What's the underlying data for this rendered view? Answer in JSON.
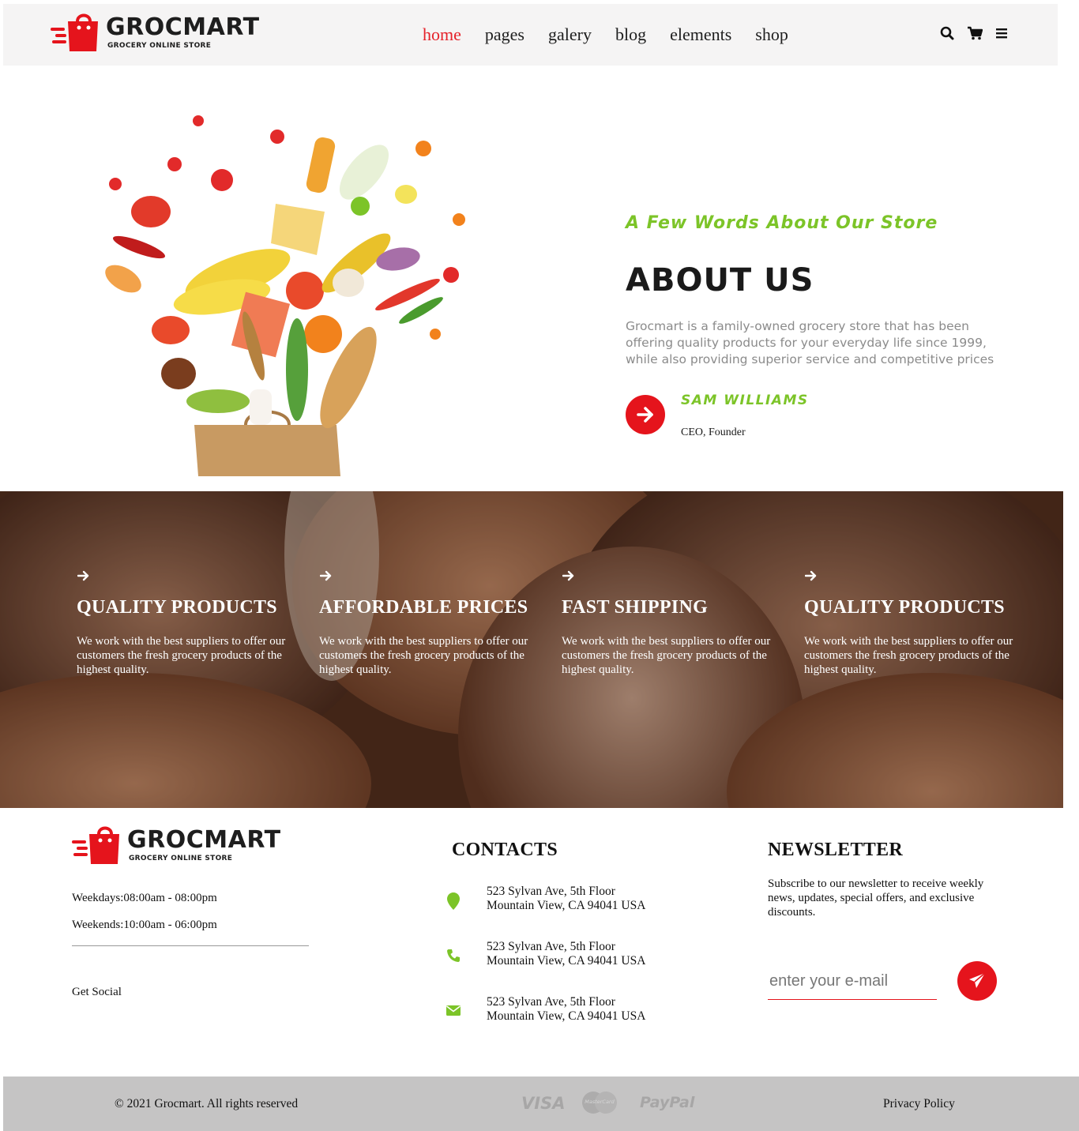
{
  "header": {
    "brand_name": "GROCMART",
    "brand_sub": "GROCERY ONLINE STORE",
    "nav": [
      "home",
      "pages",
      "galery",
      "blog",
      "elements",
      "shop"
    ],
    "active_nav": "home"
  },
  "about": {
    "tagline": "A Few Words About Our Store",
    "title": "ABOUT US",
    "text": "Grocmart is a family-owned grocery store that has been offering quality products for your everyday life since 1999, while also providing superior service and competitive prices",
    "founder_name": "SAM WILLIAMS",
    "founder_role": "CEO, Founder"
  },
  "features": [
    {
      "title": "QUALITY PRODUCTS",
      "text": "We work with the best suppliers to offer our customers the fresh grocery products of the highest quality."
    },
    {
      "title": "AFFORDABLE PRICES",
      "text": "We work with the best suppliers to offer our customers the fresh grocery products of the highest quality."
    },
    {
      "title": "FAST SHIPPING",
      "text": "We work with the best suppliers to offer our customers the fresh grocery products of the highest quality."
    },
    {
      "title": "QUALITY PRODUCTS",
      "text": "We work with the best suppliers to offer our customers the fresh grocery products of the highest quality."
    }
  ],
  "footer": {
    "weekdays": "Weekdays:08:00am - 08:00pm",
    "weekends": "Weekends:10:00am - 06:00pm",
    "social": "Get Social",
    "contacts_title": "CONTACTS",
    "contacts": [
      {
        "icon": "map-pin-icon",
        "line1": "523 Sylvan Ave, 5th Floor",
        "line2": "Mountain View, CA 94041 USA"
      },
      {
        "icon": "phone-icon",
        "line1": "523 Sylvan Ave, 5th Floor",
        "line2": "Mountain View, CA 94041 USA"
      },
      {
        "icon": "mail-icon",
        "line1": "523 Sylvan Ave, 5th Floor",
        "line2": "Mountain View, CA 94041 USA"
      }
    ],
    "newsletter_title": "NEWSLETTER",
    "newsletter_text": "Subscribe to our newsletter to receive weekly news, updates, special offers, and exclusive discounts.",
    "email_placeholder": "enter your e-mail",
    "copyright": "© 2021 Grocmart. All rights reserved",
    "privacy": "Privacy Policy",
    "payments": [
      "VISA",
      "MasterCard",
      "PayPal"
    ]
  },
  "colors": {
    "accent_red": "#e5141c",
    "accent_green": "#7cc428",
    "header_bg": "#f5f4f4",
    "bottom_bar_bg": "#c5c4c4"
  }
}
